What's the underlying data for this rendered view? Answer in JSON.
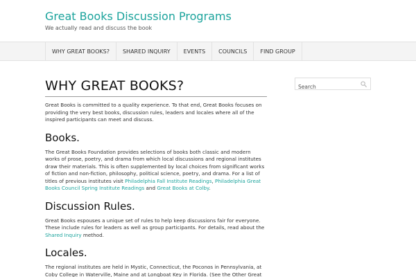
{
  "site": {
    "title": "Great Books Discussion Programs",
    "description": "We actually read and discuss the book"
  },
  "nav": {
    "items": [
      {
        "label": "WHY GREAT BOOKS?"
      },
      {
        "label": "SHARED INQUIRY"
      },
      {
        "label": "EVENTS"
      },
      {
        "label": "COUNCILS"
      },
      {
        "label": "FIND GROUP"
      }
    ]
  },
  "search": {
    "placeholder": "Search",
    "icon": "search-icon"
  },
  "page": {
    "title": "WHY GREAT BOOKS?",
    "intro": "Great Books is committed to a quality experience. To that end, Great Books focuses on providing the very best books, discussion rules, leaders and locales where all of the inspired participants can meet and discuss.",
    "books": {
      "heading": "Books.",
      "text1": "The Great Books Foundation provides selections of books both classic and modern works of prose, poetry, and drama from which local discussions and regional institutes draw their materials. This is often supplemented by local choices from significant works of fiction and non-fiction, philosophy, political science, poetry, and drama. For a list of titles of previous institutes visit ",
      "link1": "Philadelphia Fall Institute Readings",
      "sep1": ", ",
      "link2": "Philadelphia Great Books Council Spring Institute Readings",
      "sep2": " and ",
      "link3": "Great Books at Colby",
      "end": "."
    },
    "rules": {
      "heading": "Discussion Rules.",
      "text1": "Great Books espouses a unique set of rules to help keep discussions fair for everyone. These include rules for leaders as well as group participants. For details, read about the ",
      "link1": "Shared Inquiry",
      "text2": " method."
    },
    "locales": {
      "heading": "Locales.",
      "text1": "The regional institutes are held in Mystic, Connecticut, the Poconos in Pennsylvania, at Coby College in Waterville, Maine and at Longboat Key in Florida. (See the Other Great Books Links"
    }
  },
  "colors": {
    "accent": "#1ba39c",
    "nav_bg": "#f4f4f4"
  }
}
